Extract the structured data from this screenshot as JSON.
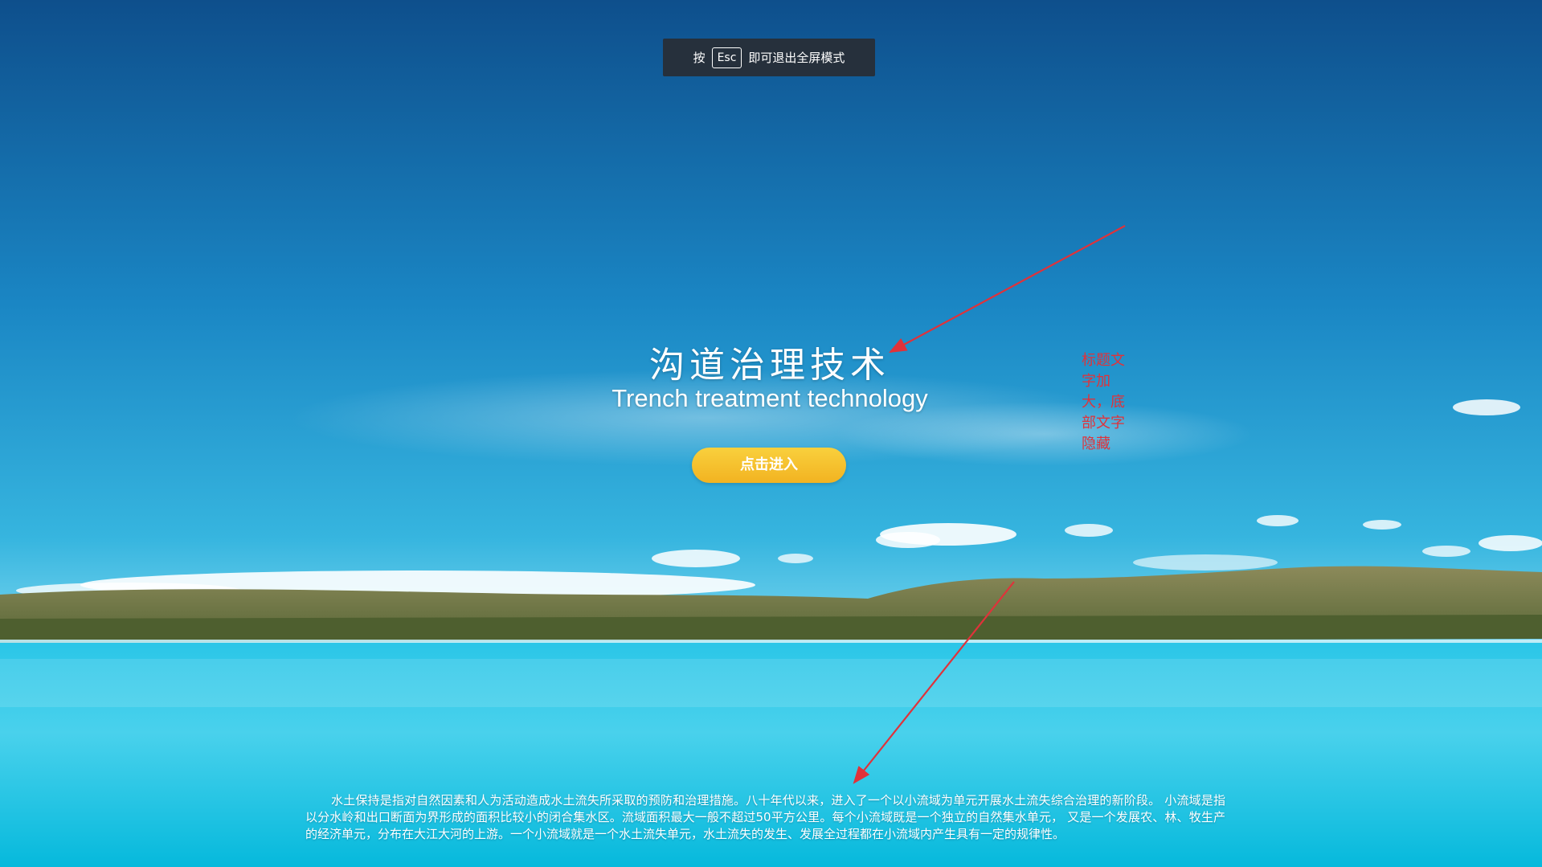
{
  "fullscreen_notice": {
    "prefix": "按",
    "key": "Esc",
    "suffix": "即可退出全屏模式"
  },
  "hero": {
    "title": "沟道治理技术",
    "subtitle": "Trench treatment technology",
    "enter_button": "点击进入"
  },
  "annotation": {
    "note": "标题文字加大，底部文字隐藏",
    "color": "#e0323a"
  },
  "footer": {
    "text": "水土保持是指对自然因素和人为活动造成水土流失所采取的预防和治理措施。八十年代以来，进入了一个以小流域为单元开展水土流失综合治理的新阶段。 小流域是指以分水岭和出口断面为界形成的面积比较小的闭合集水区。流域面积最大一般不超过50平方公里。每个小流域既是一个独立的自然集水单元， 又是一个发展农、林、牧生产的经济单元，分布在大江大河的上游。一个小流域就是一个水土流失单元，水土流失的发生、发展全过程都在小流域内产生具有一定的规律性。"
  },
  "colors": {
    "sky_top": "#0f5fa0",
    "sky_bottom": "#3cc0e2",
    "lake": "#16c4e4",
    "button": "#f5c12b"
  }
}
